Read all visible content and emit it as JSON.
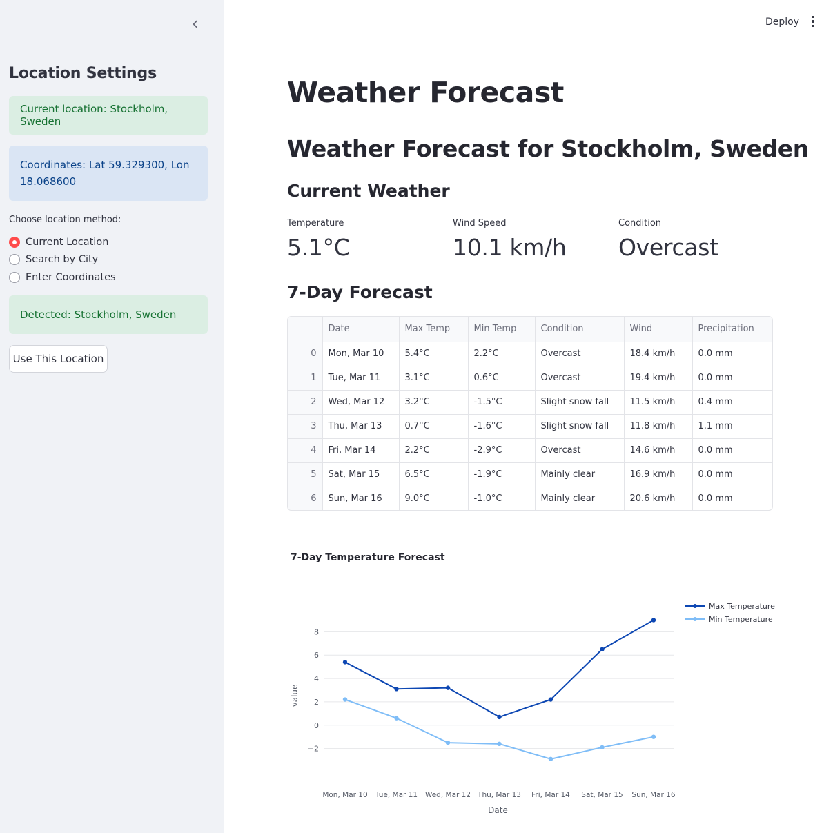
{
  "sidebar": {
    "title": "Location Settings",
    "current_location": "Current location: Stockholm, Sweden",
    "coordinates": "Coordinates: Lat 59.329300, Lon 18.068600",
    "radio_label": "Choose location method:",
    "radio_options": [
      "Current Location",
      "Search by City",
      "Enter Coordinates"
    ],
    "radio_selected": "Current Location",
    "detected": "Detected: Stockholm, Sweden",
    "use_button": "Use This Location",
    "collapse_icon": "chevron-left-icon"
  },
  "header": {
    "deploy_label": "Deploy",
    "menu_icon": "vertical-dots-icon"
  },
  "main": {
    "title": "Weather Forecast",
    "subtitle": "Weather Forecast for Stockholm, Sweden",
    "current_heading": "Current Weather",
    "metrics": [
      {
        "label": "Temperature",
        "value": "5.1°C"
      },
      {
        "label": "Wind Speed",
        "value": "10.1 km/h"
      },
      {
        "label": "Condition",
        "value": "Overcast"
      }
    ],
    "forecast_heading": "7-Day Forecast",
    "table": {
      "columns": [
        "",
        "Date",
        "Max Temp",
        "Min Temp",
        "Condition",
        "Wind",
        "Precipitation"
      ],
      "rows": [
        [
          "0",
          "Mon, Mar 10",
          "5.4°C",
          "2.2°C",
          "Overcast",
          "18.4 km/h",
          "0.0 mm"
        ],
        [
          "1",
          "Tue, Mar 11",
          "3.1°C",
          "0.6°C",
          "Overcast",
          "19.4 km/h",
          "0.0 mm"
        ],
        [
          "2",
          "Wed, Mar 12",
          "3.2°C",
          "-1.5°C",
          "Slight snow fall",
          "11.5 km/h",
          "0.4 mm"
        ],
        [
          "3",
          "Thu, Mar 13",
          "0.7°C",
          "-1.6°C",
          "Slight snow fall",
          "11.8 km/h",
          "1.1 mm"
        ],
        [
          "4",
          "Fri, Mar 14",
          "2.2°C",
          "-2.9°C",
          "Overcast",
          "14.6 km/h",
          "0.0 mm"
        ],
        [
          "5",
          "Sat, Mar 15",
          "6.5°C",
          "-1.9°C",
          "Mainly clear",
          "16.9 km/h",
          "0.0 mm"
        ],
        [
          "6",
          "Sun, Mar 16",
          "9.0°C",
          "-1.0°C",
          "Mainly clear",
          "20.6 km/h",
          "0.0 mm"
        ]
      ]
    }
  },
  "colors": {
    "accent": "#ff4b4b",
    "max_series": "#0d47b3",
    "min_series": "#7fbdf7"
  },
  "chart_data": {
    "type": "line",
    "title": "7-Day Temperature Forecast",
    "xlabel": "Date",
    "ylabel": "value",
    "categories": [
      "Mon, Mar 10",
      "Tue, Mar 11",
      "Wed, Mar 12",
      "Thu, Mar 13",
      "Fri, Mar 14",
      "Sat, Mar 15",
      "Sun, Mar 16"
    ],
    "series": [
      {
        "name": "Max Temperature",
        "values": [
          5.4,
          3.1,
          3.2,
          0.7,
          2.2,
          6.5,
          9.0
        ],
        "color": "#0d47b3"
      },
      {
        "name": "Min Temperature",
        "values": [
          2.2,
          0.6,
          -1.5,
          -1.6,
          -2.9,
          -1.9,
          -1.0
        ],
        "color": "#7fbdf7"
      }
    ],
    "yticks": [
      -2,
      0,
      2,
      4,
      6,
      8
    ],
    "ytick_labels": [
      "−2",
      "0",
      "2",
      "4",
      "6",
      "8"
    ],
    "ylim": [
      -3.5,
      9.5
    ],
    "grid": true,
    "legend": "top-right"
  }
}
